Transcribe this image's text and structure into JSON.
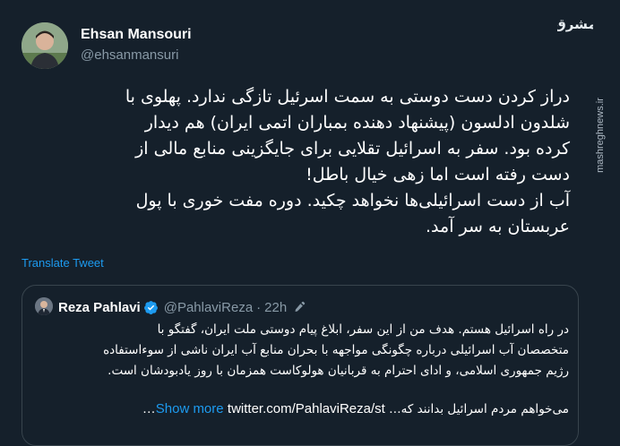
{
  "author": {
    "name": "Ehsan Mansouri",
    "handle": "@ehsanmansuri",
    "avatar_icon": "user-photo-avatar"
  },
  "watermark": {
    "logo_icon": "mashregh-logo",
    "logo_text": "مشرق",
    "url": "mashreghnews.ir"
  },
  "tweet": {
    "text": "دراز کردن دست دوستی به سمت اسرئیل تازگی ندارد. پهلوی با\nشلدون ادلسون (پیشنهاد دهنده بمباران اتمی ایران) هم دیدار\nکرده بود. سفر به اسرائیل تقلایی برای جایگزینی منابع مالی از\nدست رفته است اما زهی خیال باطل!\nآب از دست اسرائیلی‌ها نخواهد چکید. دوره مفت خوری با پول\nعربستان به سر آمد.",
    "translate_label": "Translate Tweet"
  },
  "quote": {
    "name": "Reza Pahlavi",
    "handle": "@PahlaviReza",
    "separator": "·",
    "time": "22h",
    "verified_icon": "verified-badge-icon",
    "edited_icon": "edit-pencil-icon",
    "text": "در راه اسرائیل هستم. هدف من از این سفر، ابلاغ پیام دوستی ملت ایران، گفتگو با\nمتخصصان آب اسرائیلی درباره چگونگی مواجهه با بحران منابع آب ایران ناشی از سوءاستفاده\nرژیم جمهوری اسلامی، و ادای احترام به قربانیان هولوکاست همزمان با روز یادبودشان است.",
    "last_line_text": "می‌خواهم مردم اسرائیل بدانند که…",
    "show_more": "Show more",
    "link": "twitter.com/PahlaviReza/st…"
  },
  "colors": {
    "background": "#15202b",
    "text": "#ffffff",
    "secondary_text": "#8899a6",
    "accent": "#1d9bf0",
    "border": "#38444d"
  }
}
